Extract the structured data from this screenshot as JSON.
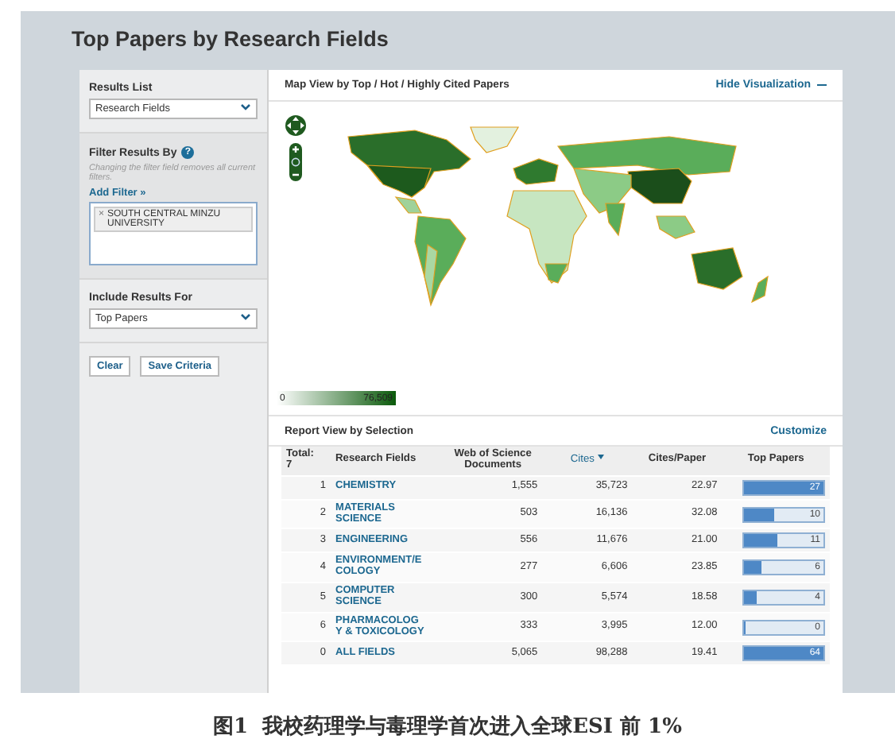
{
  "page": {
    "title": "Top Papers by Research Fields"
  },
  "sidebar": {
    "results_list": {
      "label": "Results List",
      "value": "Research Fields"
    },
    "filter": {
      "label": "Filter Results By",
      "help_icon": "?",
      "hint": "Changing the filter field removes all current filters.",
      "add_filter": "Add Filter »",
      "tokens": [
        {
          "remove": "×",
          "text": "SOUTH CENTRAL MINZU UNIVERSITY"
        }
      ]
    },
    "include": {
      "label": "Include Results For",
      "value": "Top Papers"
    },
    "buttons": [
      "Clear",
      "Save Criteria"
    ]
  },
  "map_panel": {
    "title": "Map View by Top / Hot / Highly Cited Papers",
    "hide_link": "Hide Visualization",
    "legend": {
      "min": "0",
      "max": "76,509"
    }
  },
  "report": {
    "title": "Report View by Selection",
    "customize": "Customize",
    "columns": [
      "Total:\n7",
      "Research Fields",
      "Web of Science Documents",
      "Cites",
      "Cites/Paper",
      "Top Papers"
    ],
    "rows": [
      {
        "rank": "1",
        "field": "CHEMISTRY",
        "documents": "1,555",
        "cites": "35,723",
        "cites_per_paper": "22.97",
        "top_papers": "27",
        "level": 1
      },
      {
        "rank": "2",
        "field": "MATERIALS SCIENCE",
        "documents": "503",
        "cites": "16,136",
        "cites_per_paper": "32.08",
        "top_papers": "10",
        "level": 0.37
      },
      {
        "rank": "3",
        "field": "ENGINEERING",
        "documents": "556",
        "cites": "11,676",
        "cites_per_paper": "21.00",
        "top_papers": "11",
        "level": 0.41
      },
      {
        "rank": "4",
        "field": "ENVIRONMENT/E COLOGY",
        "documents": "277",
        "cites": "6,606",
        "cites_per_paper": "23.85",
        "top_papers": "6",
        "level": 0.22
      },
      {
        "rank": "5",
        "field": "COMPUTER SCIENCE",
        "documents": "300",
        "cites": "5,574",
        "cites_per_paper": "18.58",
        "top_papers": "4",
        "level": 0.15
      },
      {
        "rank": "6",
        "field": "PHARMACOLOG Y & TOXICOLOGY",
        "documents": "333",
        "cites": "3,995",
        "cites_per_paper": "12.00",
        "top_papers": "0",
        "level": 0
      },
      {
        "rank": "0",
        "field": "ALL FIELDS",
        "documents": "5,065",
        "cites": "98,288",
        "cites_per_paper": "19.41",
        "top_papers": "64",
        "level": 1
      }
    ]
  },
  "caption": "图1  我校药理学与毒理学首次进入全球ESI 前 1%"
}
